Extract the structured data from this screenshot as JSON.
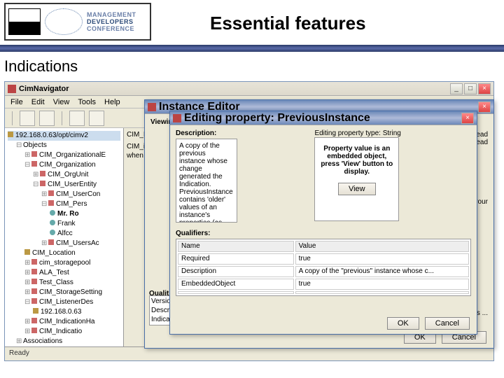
{
  "logo": {
    "l1": "MANAGEMENT",
    "l2": "DEVELOPERS",
    "l3": "CONFERENCE"
  },
  "slide": {
    "title": "Essential features",
    "subtitle": "Indications"
  },
  "app": {
    "title": "CimNavigator",
    "menus": [
      "File",
      "Edit",
      "View",
      "Tools",
      "Help"
    ],
    "status": "Ready",
    "tree": {
      "root": "192.168.0.63/opt/cimv2",
      "objects": "Objects",
      "items": [
        "CIM_OrganizationalE",
        "CIM_Organization",
        "CIM_OrgUnit",
        "CIM_UserEntity",
        "CIM_UserCon",
        "CIM_Pers",
        "Mr. Ro",
        "Frank",
        "Alfcc",
        "CIM_UsersAc",
        "CIM_Location",
        "cim_storagepool",
        "ALA_Test",
        "Test_Class",
        "CIM_StorageSetting",
        "CIM_ListenerDes",
        "192.168.0.63",
        "CIM_IndicationHa",
        "CIM_Indicatio"
      ],
      "assoc": "Associations"
    }
  },
  "dlg1": {
    "title": "Instance Editor",
    "desc_label": "Viewin",
    "foot_left": "Qualit",
    "rows": [
      "Versio",
      "Descrip",
      "Indicati"
    ],
    "ok": "OK",
    "cancel": "Cancel",
    "right_frag1": "read",
    "right_frag2": "read",
    "right_frag3": "on your",
    "right_frag4": "is ..."
  },
  "dlg2": {
    "title": "Editing property: PreviousInstance",
    "desc_label": "Description:",
    "type_label": "Editing property type: String",
    "desc_text": "A copy of the previous instance whose change generated the Indication. PreviousInstance contains 'older' values of an instance's properties (as compared to SourceInstance), selected by the IndicationFilter's Query.",
    "view_msg": "Property value is an embedded object, press 'View' button to display.",
    "view": "View",
    "qual_label": "Qualifiers:",
    "cols": [
      "Name",
      "Value"
    ],
    "rows": [
      {
        "n": "Required",
        "v": "true"
      },
      {
        "n": "Description",
        "v": "A copy of the \"previous\" instance whose c..."
      },
      {
        "n": "EmbeddedObject",
        "v": "true"
      }
    ],
    "ok": "OK",
    "cancel": "Cancel"
  }
}
